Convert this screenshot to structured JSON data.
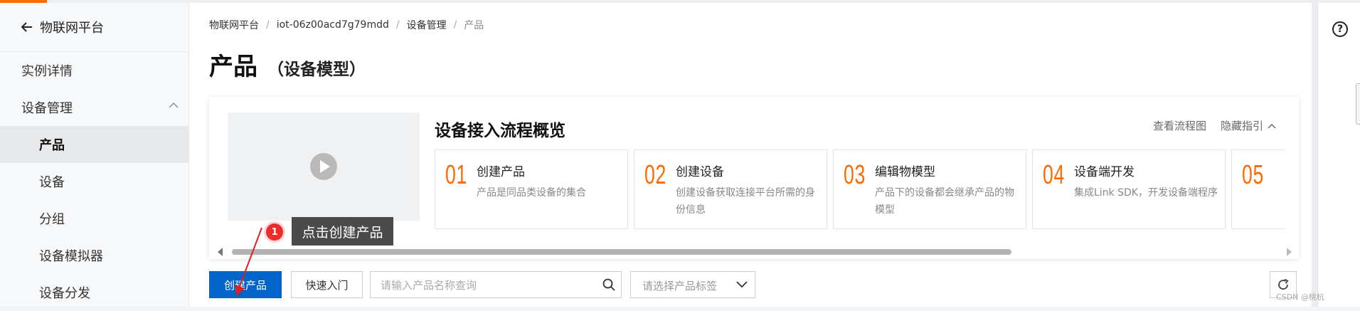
{
  "sidebar": {
    "back_label": "物联网平台",
    "items": [
      {
        "label": "实例详情"
      },
      {
        "label": "设备管理"
      },
      {
        "label": "产品"
      },
      {
        "label": "设备"
      },
      {
        "label": "分组"
      },
      {
        "label": "设备模拟器"
      },
      {
        "label": "设备分发"
      }
    ]
  },
  "breadcrumb": [
    "物联网平台",
    "iot-06z00acd7g79mdd",
    "设备管理",
    "产品"
  ],
  "page": {
    "title": "产品",
    "subtitle": "（设备模型）"
  },
  "guide": {
    "title": "设备接入流程概览",
    "link_flowchart": "查看流程图",
    "link_hide": "隐藏指引",
    "steps": [
      {
        "num": "01",
        "name": "创建产品",
        "desc": "产品是同品类设备的集合"
      },
      {
        "num": "02",
        "name": "创建设备",
        "desc": "创建设备获取连接平台所需的身份信息"
      },
      {
        "num": "03",
        "name": "编辑物模型",
        "desc": "产品下的设备都会继承产品的物模型"
      },
      {
        "num": "04",
        "name": "设备端开发",
        "desc": "集成Link SDK，开发设备端程序"
      },
      {
        "num": "05",
        "name": "",
        "desc": ""
      }
    ]
  },
  "toolbar": {
    "create_label": "创建产品",
    "quick_label": "快速入门",
    "search_placeholder": "请输入产品名称查询",
    "tag_placeholder": "请选择产品标签"
  },
  "annotation": {
    "badge": "1",
    "text": "点击创建产品"
  },
  "watermark": "CSDN @桃杭",
  "colors": {
    "primary": "#0064c8",
    "accent": "#ff6a00",
    "tooltip": "#4a4a4a",
    "badge": "#ee2b2b"
  }
}
